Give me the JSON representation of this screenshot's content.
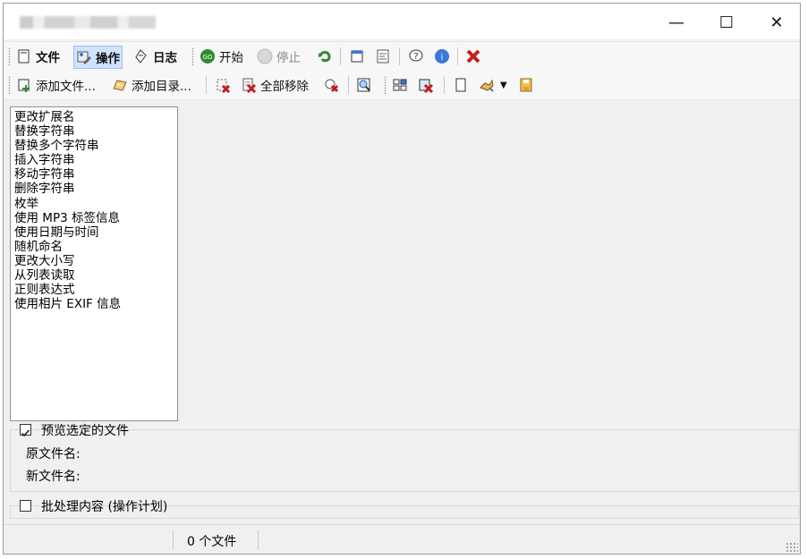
{
  "window": {
    "title_state": "blurred",
    "minimize": "—",
    "maximize": "☐",
    "close": "✕"
  },
  "toolbar1": {
    "file": "文件",
    "action": "操作",
    "log": "日志",
    "start": "开始",
    "stop": "停止"
  },
  "toolbar2": {
    "add_files": "添加文件...",
    "add_dirs": "添加目录...",
    "remove_all": "全部移除"
  },
  "operations": [
    "更改扩展名",
    "替换字符串",
    "替换多个字符串",
    "插入字符串",
    "移动字符串",
    "删除字符串",
    "枚举",
    "使用 MP3 标签信息",
    "使用日期与时间",
    "随机命名",
    "更改大小写",
    "从列表读取",
    "正则表达式",
    "使用相片 EXIF 信息"
  ],
  "preview": {
    "checkbox_checked": true,
    "label": "预览选定的文件",
    "original_label": "原文件名:",
    "new_label": "新文件名:"
  },
  "batch": {
    "checkbox_checked": false,
    "label": "批处理内容 (操作计划)"
  },
  "status": {
    "files": "0 个文件"
  },
  "colors": {
    "accent_blue": "#3a78d8",
    "go_green": "#2e8b2e",
    "close_red": "#c21f1f",
    "selected_bg": "#cfe3ff"
  },
  "icons": [
    "document-icon",
    "operation-icon",
    "log-icon",
    "go-icon",
    "stop-icon",
    "undo-icon",
    "window-icon",
    "settings-icon",
    "help-icon",
    "info-icon",
    "exit-icon",
    "add-file-icon",
    "add-folder-icon",
    "remove-icon",
    "remove-all-icon",
    "clear-icon",
    "search-icon",
    "grid-icon",
    "delete-selected-icon",
    "page-icon",
    "tools-icon",
    "save-icon"
  ]
}
